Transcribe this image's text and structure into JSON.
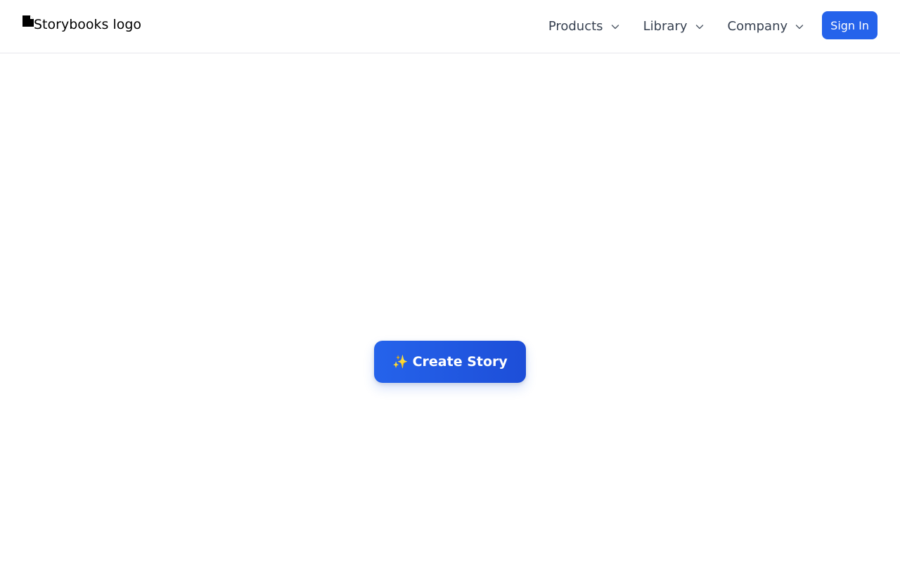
{
  "header": {
    "logo_alt": "Storybooks logo",
    "logo_icon": "broken-image-icon",
    "nav": [
      {
        "label": "Products",
        "icon": "chevron-down-icon"
      },
      {
        "label": "Library",
        "icon": "chevron-down-icon"
      },
      {
        "label": "Company",
        "icon": "chevron-down-icon"
      }
    ],
    "sign_in_label": "Sign In"
  },
  "main": {
    "create_button": {
      "icon": "sparkles-icon",
      "icon_glyph": "✨",
      "label": "Create Story"
    }
  },
  "colors": {
    "accent": "#2563eb",
    "nav_text": "#374151",
    "border": "#e5e7eb"
  }
}
